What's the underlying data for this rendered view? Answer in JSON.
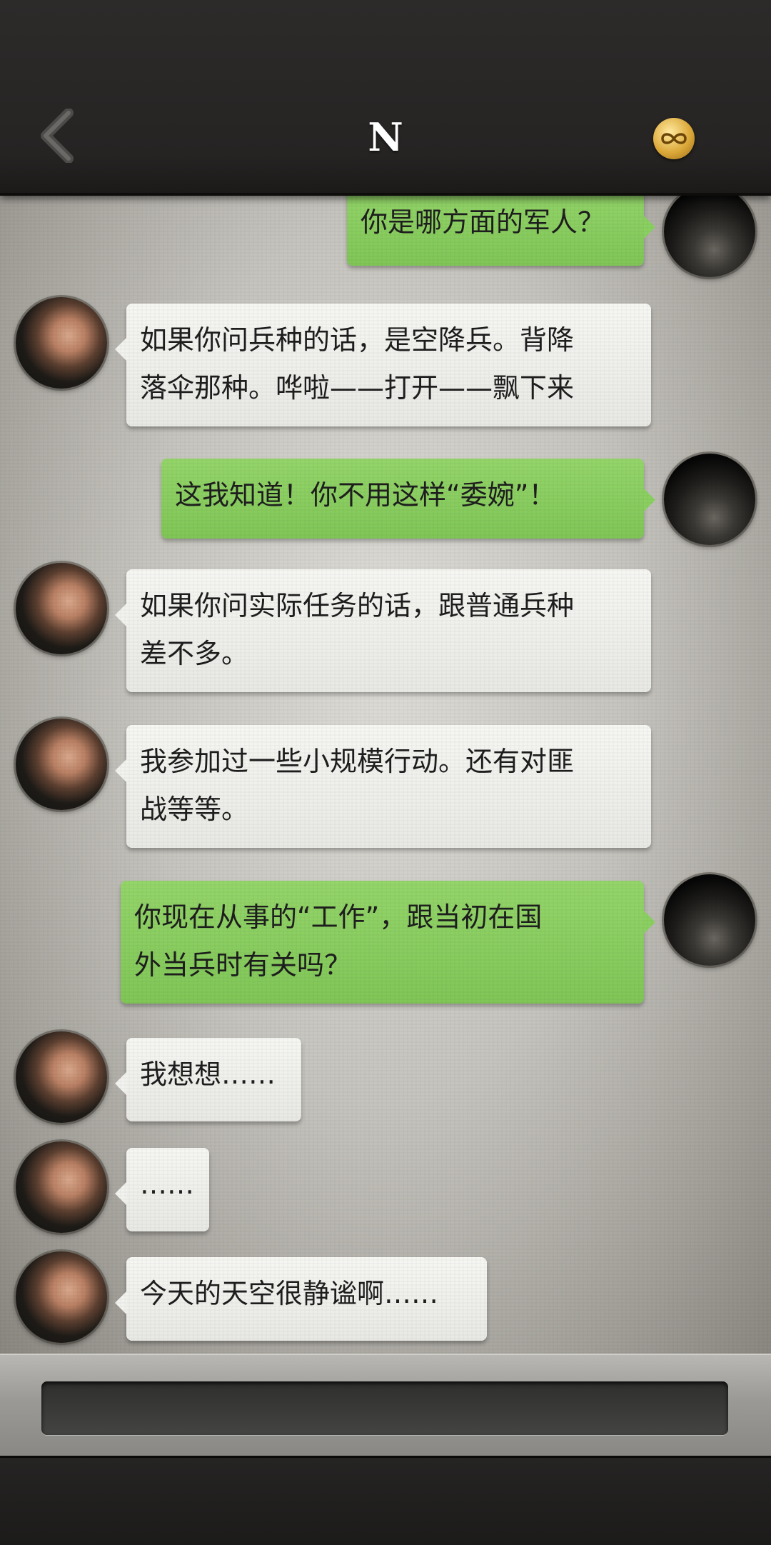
{
  "header": {
    "title": "N",
    "back_icon": "chevron-left-icon",
    "menu_icon": "infinity-badge-icon",
    "accent_gold": "#dca93a"
  },
  "colors": {
    "bubble_sent": "#8ad060",
    "bubble_received": "#efefeb"
  },
  "messages": [
    {
      "side": "right",
      "lines": [
        "你是哪方面的军人？"
      ]
    },
    {
      "side": "left",
      "lines": [
        "如果你问兵种的话，是空降兵。背降",
        "落伞那种。哗啦——打开——飘下来"
      ]
    },
    {
      "side": "right",
      "lines": [
        "这我知道！你不用这样“委婉”！"
      ]
    },
    {
      "side": "left",
      "lines": [
        "如果你问实际任务的话，跟普通兵种",
        "差不多。"
      ]
    },
    {
      "side": "left",
      "lines": [
        "我参加过一些小规模行动。还有对匪",
        "战等等。"
      ]
    },
    {
      "side": "right",
      "lines": [
        "你现在从事的“工作”，跟当初在国",
        "外当兵时有关吗？"
      ]
    },
    {
      "side": "left",
      "lines": [
        "我想想……"
      ]
    },
    {
      "side": "left",
      "lines": [
        "……"
      ]
    },
    {
      "side": "left",
      "lines": [
        "今天的天空很静谧啊……"
      ]
    }
  ],
  "composer": {
    "value": "",
    "placeholder": ""
  }
}
